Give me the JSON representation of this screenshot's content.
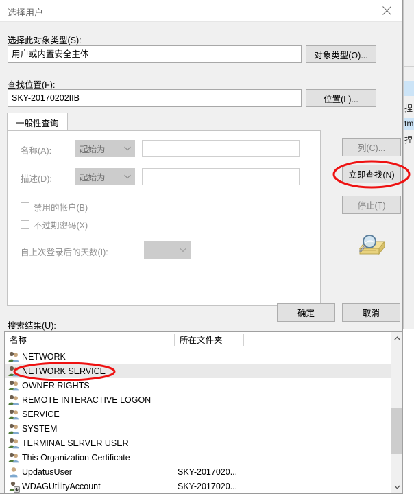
{
  "window": {
    "title": "选择用户",
    "close_icon": "close-icon"
  },
  "object_type": {
    "label": "选择此对象类型(S):",
    "value": "用户或内置安全主体",
    "button_label": "对象类型(O)..."
  },
  "location": {
    "label": "查找位置(F):",
    "value": "SKY-20170202IIB",
    "button_label": "位置(L)..."
  },
  "tabs": [
    {
      "label": "一般性查询",
      "active": true
    }
  ],
  "query": {
    "name_label": "名称(A):",
    "name_condition": "起始为",
    "name_value": "",
    "desc_label": "描述(D):",
    "desc_condition": "起始为",
    "desc_value": "",
    "disabled_accounts_label": "禁用的帐户(B)",
    "disabled_accounts_checked": false,
    "non_expiring_password_label": "不过期密码(X)",
    "non_expiring_password_checked": false,
    "days_since_logon_label": "自上次登录后的天数(I):",
    "days_since_logon_value": ""
  },
  "side_buttons": {
    "columns_label": "列(C)...",
    "columns_enabled": false,
    "find_now_label": "立即查找(N)",
    "find_now_enabled": true,
    "stop_label": "停止(T)",
    "stop_enabled": false,
    "find_icon": "magnifier-folder-icon"
  },
  "dialog_buttons": {
    "ok_label": "确定",
    "cancel_label": "取消"
  },
  "results": {
    "label": "搜索结果(U):",
    "columns": [
      "名称",
      "所在文件夹"
    ],
    "rows": [
      {
        "name": "NETWORK",
        "folder": "",
        "icon": "group-icon",
        "selected": false
      },
      {
        "name": "NETWORK SERVICE",
        "folder": "",
        "icon": "group-icon",
        "selected": true
      },
      {
        "name": "OWNER RIGHTS",
        "folder": "",
        "icon": "group-icon",
        "selected": false
      },
      {
        "name": "REMOTE INTERACTIVE LOGON",
        "folder": "",
        "icon": "group-icon",
        "selected": false
      },
      {
        "name": "SERVICE",
        "folder": "",
        "icon": "group-icon",
        "selected": false
      },
      {
        "name": "SYSTEM",
        "folder": "",
        "icon": "group-icon",
        "selected": false
      },
      {
        "name": "TERMINAL SERVER USER",
        "folder": "",
        "icon": "group-icon",
        "selected": false
      },
      {
        "name": "This Organization Certificate",
        "folder": "",
        "icon": "group-icon",
        "selected": false
      },
      {
        "name": "UpdatusUser",
        "folder": "SKY-2017020...",
        "icon": "user-icon",
        "selected": false
      },
      {
        "name": "WDAGUtilityAccount",
        "folder": "SKY-2017020...",
        "icon": "user-badge-icon",
        "selected": false
      }
    ]
  },
  "annotations": {
    "ellipse_find_now": "red-ellipse-highlight",
    "ellipse_network_service": "red-ellipse-highlight",
    "color": "#ee1111"
  }
}
